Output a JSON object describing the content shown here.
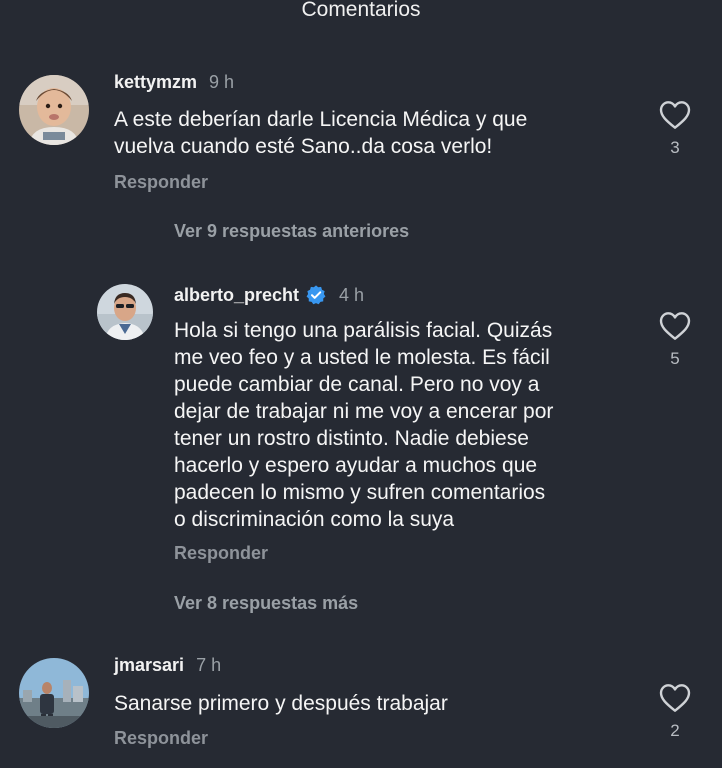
{
  "header": {
    "title": "Comentarios"
  },
  "comments": [
    {
      "username": "kettymzm",
      "time": "9 h",
      "text": "A este deberían darle Licencia Médica y que\nvuelva cuando esté Sano..da cosa verlo!",
      "reply_label": "Responder",
      "likes": "3",
      "avatar_icon": "baby-photo-avatar"
    },
    {
      "username": "alberto_precht",
      "time": "4 h",
      "verified": true,
      "text": "Hola si tengo una parálisis facial. Quizás\nme veo feo y a usted le molesta. Es fácil\npuede cambiar de canal. Pero no voy a\ndejar de trabajar ni me voy a encerar por\ntener un rostro distinto. Nadie debiese\nhacerlo y espero ayudar a muchos que\npadecen lo mismo y sufren comentarios\no discriminación como la suya",
      "reply_label": "Responder",
      "likes": "5",
      "avatar_icon": "man-sunglasses-avatar"
    },
    {
      "username": "jmarsari",
      "time": "7 h",
      "text": "Sanarse primero y después trabajar",
      "reply_label": "Responder",
      "likes": "2",
      "avatar_icon": "man-city-avatar"
    }
  ],
  "thread": {
    "view_previous": "Ver 9 respuestas anteriores",
    "view_more": "Ver 8 respuestas más"
  },
  "colors": {
    "background": "#262a33",
    "text": "#f5f5f5",
    "muted": "#9aa0a6",
    "verified": "#3897f0"
  }
}
